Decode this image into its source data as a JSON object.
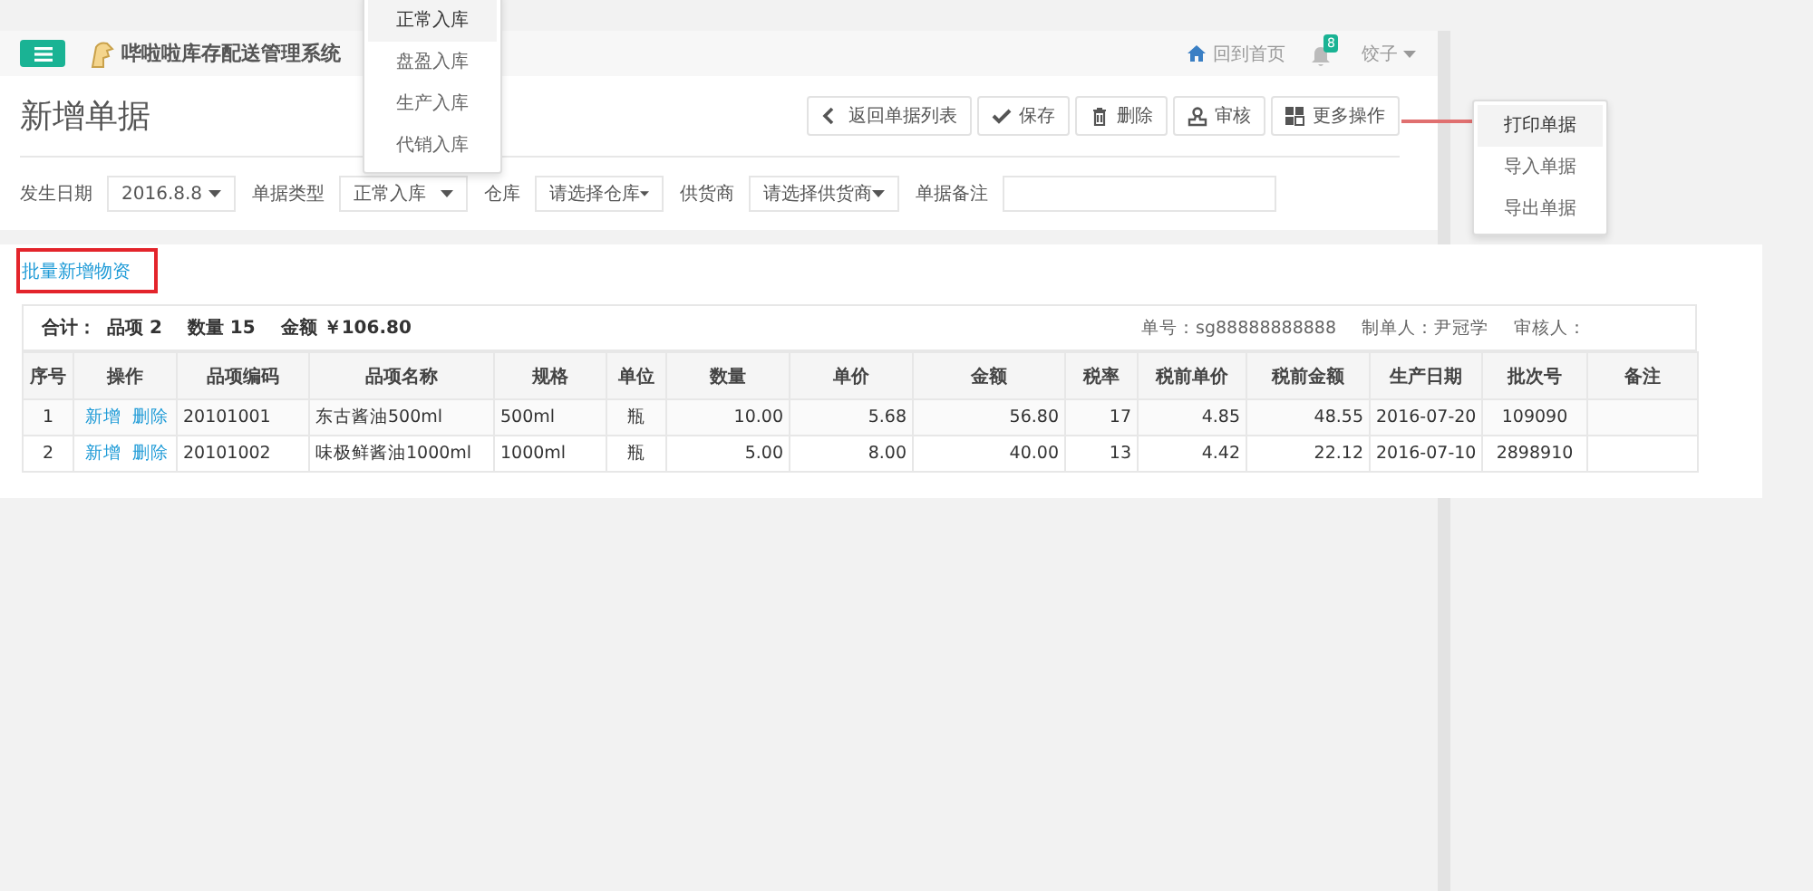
{
  "app": {
    "title": "哔啦啦库存配送管理系统",
    "home_link": "回到首页",
    "notification_count": "8",
    "user": "饺子"
  },
  "page": {
    "title": "新增单据"
  },
  "toolbar": [
    {
      "kind": "back",
      "label": "返回单据列表"
    },
    {
      "kind": "save",
      "label": "保存"
    },
    {
      "kind": "delete",
      "label": "删除"
    },
    {
      "kind": "audit",
      "label": "审核"
    },
    {
      "kind": "more",
      "label": "更多操作"
    }
  ],
  "filters": [
    {
      "kind": "select",
      "label": "发生日期",
      "value": "2016.8.8"
    },
    {
      "kind": "select",
      "label": "单据类型",
      "value": "正常入库"
    },
    {
      "kind": "select",
      "label": "仓库",
      "value": "请选择仓库"
    },
    {
      "kind": "select",
      "label": "供货商",
      "value": "请选择供货商"
    },
    {
      "kind": "input",
      "label": "单据备注"
    }
  ],
  "type_menu": [
    {
      "label": "正常入库",
      "selected": true
    },
    {
      "label": "盘盈入库",
      "selected": false
    },
    {
      "label": "生产入库",
      "selected": false
    },
    {
      "label": "代销入库",
      "selected": false
    }
  ],
  "more_menu": [
    {
      "label": "打印单据",
      "selected": true
    },
    {
      "label": "导入单据",
      "selected": false
    },
    {
      "label": "导出单据",
      "selected": false
    }
  ],
  "batch_link": "批量新增物资",
  "summary": {
    "label": "合计：",
    "items": [
      {
        "label": "品项",
        "value": "2"
      },
      {
        "label": "数量",
        "value": "15"
      },
      {
        "label": "金额",
        "value": "￥106.80"
      }
    ]
  },
  "meta": [
    {
      "label": "单号：",
      "value": "sg88888888888"
    },
    {
      "label": "制单人：",
      "value": "尹冠学"
    },
    {
      "label": "审核人："
    }
  ],
  "table": {
    "columns": [
      "序号",
      "操作",
      "品项编码",
      "品项名称",
      "规格",
      "单位",
      "数量",
      "单价",
      "金额",
      "税率",
      "税前单价",
      "税前金额",
      "生产日期",
      "批次号",
      "备注"
    ],
    "rows": [
      {
        "cells": [
          "1",
          "",
          "20101001",
          "东古酱油500ml",
          "500ml",
          "瓶",
          "10.00",
          "5.68",
          "56.80",
          "17",
          "4.85",
          "48.55",
          "2016-07-20",
          "109090",
          ""
        ],
        "actions": [
          "新增",
          "删除"
        ]
      },
      {
        "cells": [
          "2",
          "",
          "20101002",
          "味极鲜酱油1000ml",
          "1000ml",
          "瓶",
          "5.00",
          "8.00",
          "40.00",
          "13",
          "4.42",
          "22.12",
          "2016-07-10",
          "2898910",
          ""
        ],
        "actions": [
          "新增",
          "删除"
        ]
      }
    ]
  }
}
